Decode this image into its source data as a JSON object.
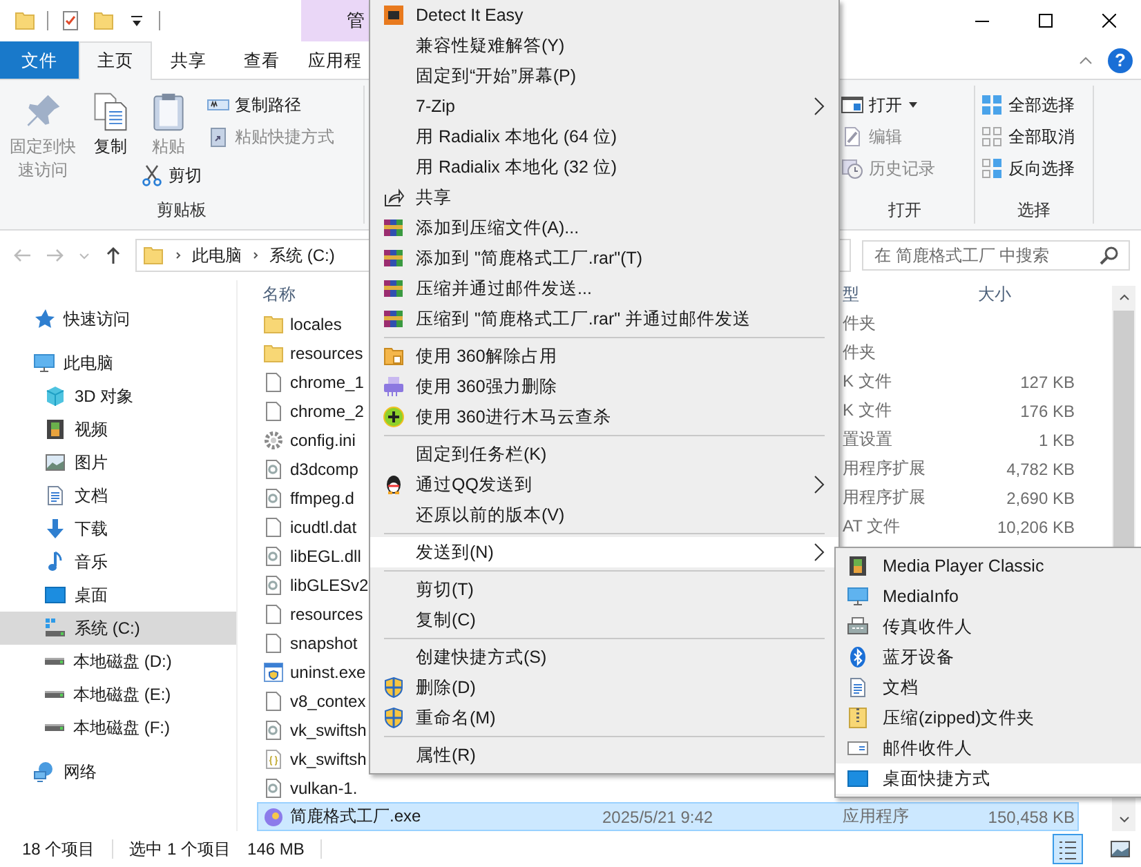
{
  "title_bar": {
    "contextual_tab": "管"
  },
  "ribbon_tabs": [
    {
      "label": "文件",
      "kind": "file",
      "selected": false
    },
    {
      "label": "主页",
      "kind": "tab",
      "selected": true
    },
    {
      "label": "共享",
      "kind": "tab",
      "selected": false
    },
    {
      "label": "查看",
      "kind": "tab",
      "selected": false
    },
    {
      "label": "应用程",
      "kind": "tab",
      "selected": false
    }
  ],
  "help_button": "?",
  "clipboard_group": {
    "label": "剪贴板",
    "commands": [
      {
        "label": "固定到快速访问",
        "disabled": true
      },
      {
        "label": "复制",
        "disabled": false
      },
      {
        "label": "粘贴",
        "disabled": true
      },
      {
        "label": "剪切",
        "disabled": false
      },
      {
        "label": "复制路径",
        "disabled": false
      },
      {
        "label": "粘贴快捷方式",
        "disabled": true
      }
    ]
  },
  "open_group": {
    "label": "打开",
    "commands": [
      {
        "label": "打开",
        "disabled": false
      },
      {
        "label": "编辑",
        "disabled": true
      },
      {
        "label": "历史记录",
        "disabled": true
      }
    ]
  },
  "select_group": {
    "label": "选择",
    "commands": [
      {
        "label": "全部选择",
        "disabled": false
      },
      {
        "label": "全部取消",
        "disabled": false
      },
      {
        "label": "反向选择",
        "disabled": false
      }
    ]
  },
  "address_bar": {
    "path": [
      "此电脑",
      "系统 (C:)"
    ]
  },
  "search": {
    "placeholder": "在 简鹿格式工厂 中搜索"
  },
  "navigation_pane": {
    "items": [
      {
        "label": "快速访问",
        "selected": false
      },
      {
        "label": "此电脑",
        "selected": false,
        "children": [
          {
            "label": "3D 对象",
            "selected": false
          },
          {
            "label": "视频",
            "selected": false
          },
          {
            "label": "图片",
            "selected": false
          },
          {
            "label": "文档",
            "selected": false
          },
          {
            "label": "下载",
            "selected": false
          },
          {
            "label": "音乐",
            "selected": false
          },
          {
            "label": "桌面",
            "selected": false
          },
          {
            "label": "系统 (C:)",
            "selected": true
          },
          {
            "label": "本地磁盘 (D:)",
            "selected": false
          },
          {
            "label": "本地磁盘 (E:)",
            "selected": false
          },
          {
            "label": "本地磁盘 (F:)",
            "selected": false
          }
        ]
      },
      {
        "label": "网络",
        "selected": false
      }
    ]
  },
  "file_list": {
    "columns": [
      "名称",
      "型",
      "大小"
    ],
    "rows": [
      {
        "name": "locales",
        "type": "件夹",
        "selected": false
      },
      {
        "name": "resources",
        "type": "件夹",
        "selected": false
      },
      {
        "name": "chrome_1",
        "type": "K 文件",
        "size": "127 KB",
        "selected": false
      },
      {
        "name": "chrome_2",
        "type": "K 文件",
        "size": "176 KB",
        "selected": false
      },
      {
        "name": "config.ini",
        "type": "置设置",
        "size": "1 KB",
        "selected": false
      },
      {
        "name": "d3dcomp",
        "type": "用程序扩展",
        "size": "4,782 KB",
        "selected": false
      },
      {
        "name": "ffmpeg.d",
        "type": "用程序扩展",
        "size": "2,690 KB",
        "selected": false
      },
      {
        "name": "icudtl.dat",
        "type": "AT 文件",
        "size": "10,206 KB",
        "selected": false
      },
      {
        "name": "libEGL.dll",
        "selected": false
      },
      {
        "name": "libGLESv2",
        "selected": false
      },
      {
        "name": "resources",
        "selected": false
      },
      {
        "name": "snapshot",
        "selected": false
      },
      {
        "name": "uninst.exe",
        "selected": false
      },
      {
        "name": "v8_contex",
        "selected": false
      },
      {
        "name": "vk_swiftsh",
        "selected": false
      },
      {
        "name": "vk_swiftsh",
        "selected": false
      },
      {
        "name": "vulkan-1.",
        "selected": false
      },
      {
        "name": "简鹿格式工厂.exe",
        "date": "2025/5/21 9:42",
        "type": "应用程序",
        "size": "150,458 KB",
        "selected": true
      }
    ]
  },
  "context_menu": {
    "items": [
      {
        "kind": "item",
        "label": "Detect It Easy",
        "submenu": false,
        "selected": false
      },
      {
        "kind": "item",
        "label": "兼容性疑难解答(Y)",
        "submenu": false,
        "selected": false
      },
      {
        "kind": "item",
        "label": "固定到“开始”屏幕(P)",
        "submenu": false,
        "selected": false
      },
      {
        "kind": "item",
        "label": "7-Zip",
        "submenu": true,
        "selected": false
      },
      {
        "kind": "item",
        "label": "用 Radialix 本地化 (64 位)",
        "submenu": false,
        "selected": false
      },
      {
        "kind": "item",
        "label": "用 Radialix 本地化 (32 位)",
        "submenu": false,
        "selected": false
      },
      {
        "kind": "item",
        "label": "共享",
        "submenu": false,
        "selected": false
      },
      {
        "kind": "item",
        "label": "添加到压缩文件(A)...",
        "submenu": false,
        "selected": false
      },
      {
        "kind": "item",
        "label": "添加到 \"简鹿格式工厂.rar\"(T)",
        "submenu": false,
        "selected": false
      },
      {
        "kind": "item",
        "label": "压缩并通过邮件发送...",
        "submenu": false,
        "selected": false
      },
      {
        "kind": "item",
        "label": "压缩到 \"简鹿格式工厂.rar\" 并通过邮件发送",
        "submenu": false,
        "selected": false
      },
      {
        "kind": "separator"
      },
      {
        "kind": "item",
        "label": "使用 360解除占用",
        "submenu": false,
        "selected": false
      },
      {
        "kind": "item",
        "label": "使用 360强力删除",
        "submenu": false,
        "selected": false
      },
      {
        "kind": "item",
        "label": "使用 360进行木马云查杀",
        "submenu": false,
        "selected": false
      },
      {
        "kind": "separator"
      },
      {
        "kind": "item",
        "label": "固定到任务栏(K)",
        "submenu": false,
        "selected": false
      },
      {
        "kind": "item",
        "label": "通过QQ发送到",
        "submenu": true,
        "selected": false
      },
      {
        "kind": "item",
        "label": "还原以前的版本(V)",
        "submenu": false,
        "selected": false
      },
      {
        "kind": "separator"
      },
      {
        "kind": "item",
        "label": "发送到(N)",
        "submenu": true,
        "selected": true
      },
      {
        "kind": "separator"
      },
      {
        "kind": "item",
        "label": "剪切(T)",
        "submenu": false,
        "selected": false
      },
      {
        "kind": "item",
        "label": "复制(C)",
        "submenu": false,
        "selected": false
      },
      {
        "kind": "separator"
      },
      {
        "kind": "item",
        "label": "创建快捷方式(S)",
        "submenu": false,
        "selected": false
      },
      {
        "kind": "item",
        "label": "删除(D)",
        "submenu": false,
        "selected": false
      },
      {
        "kind": "item",
        "label": "重命名(M)",
        "submenu": false,
        "selected": false
      },
      {
        "kind": "separator"
      },
      {
        "kind": "item",
        "label": "属性(R)",
        "submenu": false,
        "selected": false
      }
    ]
  },
  "send_to_menu": {
    "items": [
      {
        "label": "Media Player Classic",
        "selected": false
      },
      {
        "label": "MediaInfo",
        "selected": false
      },
      {
        "label": "传真收件人",
        "selected": false
      },
      {
        "label": "蓝牙设备",
        "selected": false
      },
      {
        "label": "文档",
        "selected": false
      },
      {
        "label": "压缩(zipped)文件夹",
        "selected": false
      },
      {
        "label": "邮件收件人",
        "selected": false
      },
      {
        "label": "桌面快捷方式",
        "selected": true
      }
    ]
  },
  "status_bar": {
    "item_count": "18 个项目",
    "selection": "选中 1 个项目",
    "selection_size": "146 MB"
  },
  "view_buttons": [
    {
      "selected": true
    },
    {
      "selected": false
    }
  ]
}
